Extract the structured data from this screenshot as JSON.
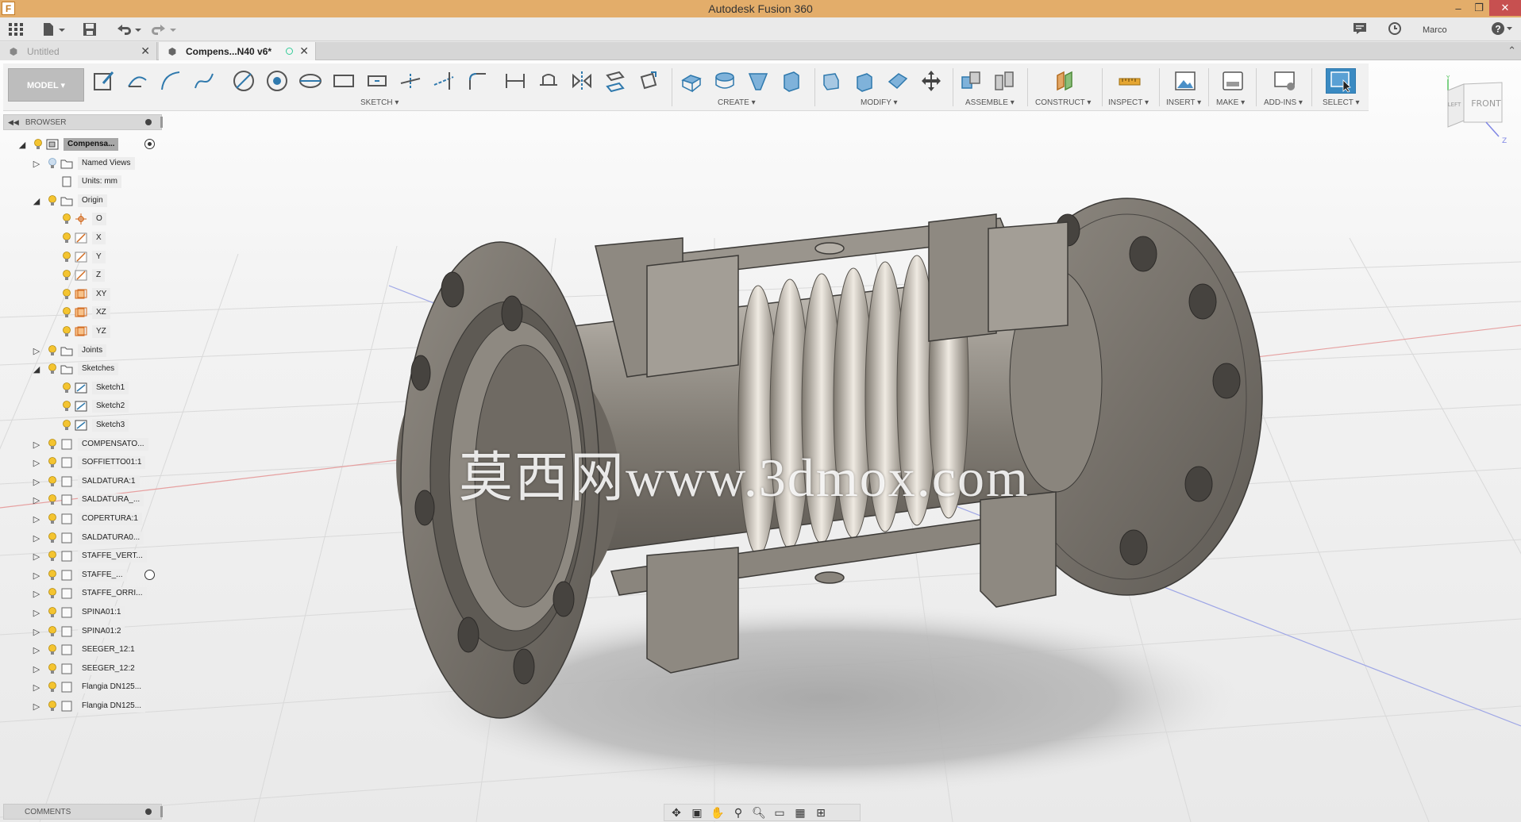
{
  "app": {
    "title": "Autodesk Fusion 360",
    "logo_letter": "F",
    "user": "Marco"
  },
  "tabs": [
    {
      "label": "Untitled",
      "active": false
    },
    {
      "label": "Compens...N40 v6*",
      "active": true
    }
  ],
  "toolbar": {
    "workspace": "MODEL ▾",
    "groups": {
      "sketch": "SKETCH ▾",
      "create": "CREATE ▾",
      "modify": "MODIFY ▾",
      "assemble": "ASSEMBLE ▾",
      "construct": "CONSTRUCT ▾",
      "inspect": "INSPECT ▾",
      "insert": "INSERT ▾",
      "make": "MAKE ▾",
      "addins": "ADD-INS ▾",
      "select": "SELECT ▾"
    }
  },
  "browser": {
    "title": "BROWSER",
    "root": "Compensa...",
    "items": [
      {
        "label": "Named Views"
      },
      {
        "label": "Units: mm"
      },
      {
        "label": "Origin"
      },
      {
        "label": "O"
      },
      {
        "label": "X"
      },
      {
        "label": "Y"
      },
      {
        "label": "Z"
      },
      {
        "label": "XY"
      },
      {
        "label": "XZ"
      },
      {
        "label": "YZ"
      },
      {
        "label": "Joints"
      },
      {
        "label": "Sketches"
      },
      {
        "label": "Sketch1"
      },
      {
        "label": "Sketch2"
      },
      {
        "label": "Sketch3"
      },
      {
        "label": "COMPENSATO..."
      },
      {
        "label": "SOFFIETTO01:1"
      },
      {
        "label": "SALDATURA:1"
      },
      {
        "label": "SALDATURA_..."
      },
      {
        "label": "COPERTURA:1"
      },
      {
        "label": "SALDATURA0..."
      },
      {
        "label": "STAFFE_VERT..."
      },
      {
        "label": "STAFFE_..."
      },
      {
        "label": "STAFFE_ORRI..."
      },
      {
        "label": "SPINA01:1"
      },
      {
        "label": "SPINA01:2"
      },
      {
        "label": "SEEGER_12:1"
      },
      {
        "label": "SEEGER_12:2"
      },
      {
        "label": "Flangia DN125..."
      },
      {
        "label": "Flangia DN125..."
      }
    ]
  },
  "comments": {
    "title": "COMMENTS"
  },
  "viewcube": {
    "front": "FRONT",
    "left": "LEFT",
    "axis_y": "Y",
    "axis_z": "Z"
  },
  "watermark": "莫西网www.3dmox.com",
  "colors": {
    "titlebar": "#e3ad6a",
    "select_active": "#3a8ac2"
  }
}
